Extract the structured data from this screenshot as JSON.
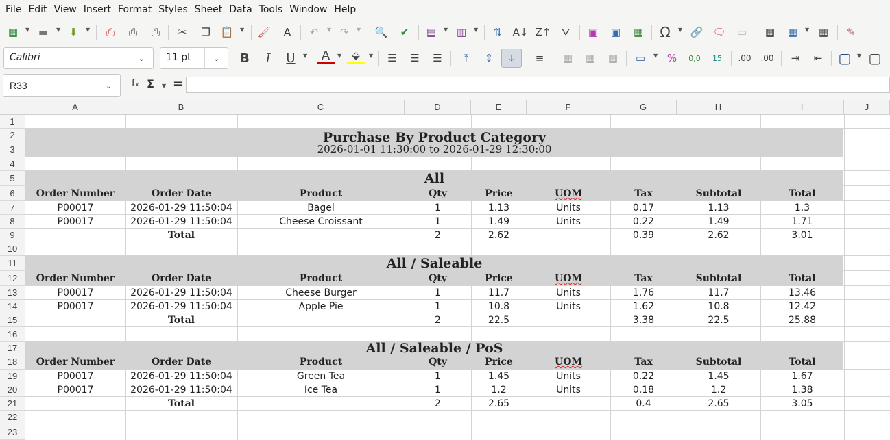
{
  "menu": [
    "File",
    "Edit",
    "View",
    "Insert",
    "Format",
    "Styles",
    "Sheet",
    "Data",
    "Tools",
    "Window",
    "Help"
  ],
  "font": {
    "name": "Calibri",
    "size": "11 pt"
  },
  "cell_ref": "R33",
  "formula": "",
  "columns": [
    "A",
    "B",
    "C",
    "D",
    "E",
    "F",
    "G",
    "H",
    "I",
    "J"
  ],
  "rows": [
    "1",
    "2",
    "3",
    "4",
    "5",
    "6",
    "7",
    "8",
    "9",
    "10",
    "11",
    "12",
    "13",
    "14",
    "15",
    "16",
    "17",
    "18",
    "19",
    "20",
    "21",
    "22",
    "23"
  ],
  "report": {
    "title": "Purchase By Product Category",
    "range": "2026-01-01 11:30:00 to 2026-01-29 12:30:00",
    "headers": [
      "Order Number",
      "Order Date",
      "Product",
      "Qty",
      "Price",
      "UOM",
      "Tax",
      "Subtotal",
      "Total"
    ],
    "total_label": "Total",
    "sections": [
      {
        "name": "All",
        "items": [
          [
            "P00017",
            "2026-01-29 11:50:04",
            "Bagel",
            "1",
            "1.13",
            "Units",
            "0.17",
            "1.13",
            "1.3"
          ],
          [
            "P00017",
            "2026-01-29 11:50:04",
            "Cheese Croissant",
            "1",
            "1.49",
            "Units",
            "0.22",
            "1.49",
            "1.71"
          ]
        ],
        "totals": {
          "qty": "2",
          "price": "2.62",
          "tax": "0.39",
          "subtotal": "2.62",
          "total": "3.01"
        }
      },
      {
        "name": "All / Saleable",
        "items": [
          [
            "P00017",
            "2026-01-29 11:50:04",
            "Cheese Burger",
            "1",
            "11.7",
            "Units",
            "1.76",
            "11.7",
            "13.46"
          ],
          [
            "P00017",
            "2026-01-29 11:50:04",
            "Apple Pie",
            "1",
            "10.8",
            "Units",
            "1.62",
            "10.8",
            "12.42"
          ]
        ],
        "totals": {
          "qty": "2",
          "price": "22.5",
          "tax": "3.38",
          "subtotal": "22.5",
          "total": "25.88"
        }
      },
      {
        "name": "All / Saleable / PoS",
        "items": [
          [
            "P00017",
            "2026-01-29 11:50:04",
            "Green Tea",
            "1",
            "1.45",
            "Units",
            "0.22",
            "1.45",
            "1.67"
          ],
          [
            "P00017",
            "2026-01-29 11:50:04",
            "Ice Tea",
            "1",
            "1.2",
            "Units",
            "0.18",
            "1.2",
            "1.38"
          ]
        ],
        "totals": {
          "qty": "2",
          "price": "2.65",
          "tax": "0.4",
          "subtotal": "2.65",
          "total": "3.05"
        }
      }
    ]
  }
}
